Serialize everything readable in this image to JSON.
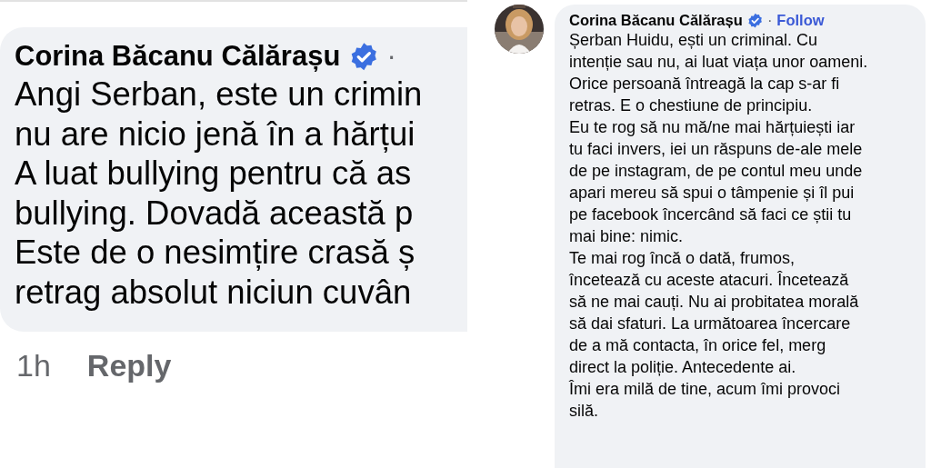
{
  "comments": [
    {
      "kind": "cropped",
      "author": "Corina Băcanu Călărașu",
      "verified": true,
      "separator": "·",
      "lines": [
        "Angi Serban, este un crimin",
        "nu are nicio jenă în a hărțui",
        "A luat bullying pentru că as",
        "bullying. Dovadă această p",
        "Este de o nesimțire crasă ș",
        "retrag absolut niciun cuvân"
      ],
      "time": "1h",
      "reply": "Reply"
    },
    {
      "kind": "full",
      "author": "Corina Băcanu Călărașu",
      "verified": true,
      "separator": "·",
      "follow": "Follow",
      "lines": [
        "Șerban Huidu, ești un criminal. Cu",
        "intenție sau nu, ai luat viața unor oameni.",
        "Orice persoană întreagă la cap s-ar fi",
        "retras. E o chestiune de principiu.",
        "Eu te rog să nu mă/ne mai hărțuiești iar",
        "tu faci invers, iei un răspuns de-ale mele",
        "de pe instagram, de pe contul meu unde",
        "apari mereu să spui o tâmpenie și îl pui",
        "pe facebook încercând să faci ce știi tu",
        "mai bine: nimic.",
        "Te mai rog încă o dată, frumos,",
        "încetează cu aceste atacuri. Încetează",
        "să ne mai cauți. Nu ai probitatea morală",
        "să dai sfaturi. La următoarea încercare",
        "de a mă contacta, în orice fel, merg",
        "direct la poliție. Antecedente ai.",
        "Îmi era milă de tine, acum îmi provoci",
        "silă."
      ]
    }
  ]
}
